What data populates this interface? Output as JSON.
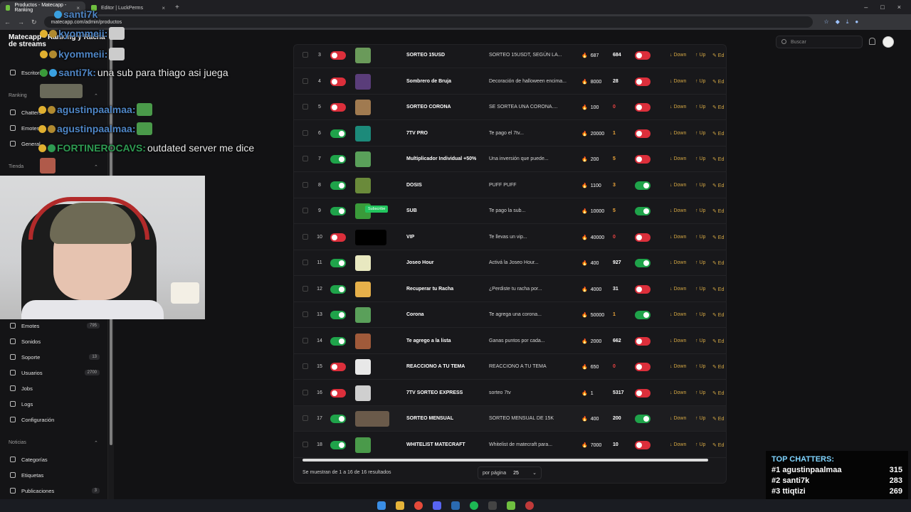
{
  "browser": {
    "tabs": [
      {
        "label": "Productos - Matecapp - Ranking",
        "active": true
      },
      {
        "label": "Editor | LuckPerms",
        "active": false
      }
    ],
    "url": "matecapp.com/admin/productos",
    "new_tab": "+"
  },
  "sidebar": {
    "brand": "Matecapp - Ranking y Racha de streams",
    "items_top": [
      {
        "label": "Escritorio"
      }
    ],
    "section_ranking": "Ranking",
    "ranking_items": [
      {
        "label": "Chatters"
      },
      {
        "label": "Emotes"
      },
      {
        "label": "General"
      }
    ],
    "section_tienda": "Tienda",
    "items_bottom": [
      {
        "label": "Emotes",
        "badge": "795"
      },
      {
        "label": "Sonidos",
        "badge": ""
      },
      {
        "label": "Soporte",
        "badge": "13"
      },
      {
        "label": "Usuarios",
        "badge": "2700"
      },
      {
        "label": "Jobs",
        "badge": ""
      },
      {
        "label": "Logs",
        "badge": ""
      },
      {
        "label": "Configuración",
        "badge": ""
      }
    ],
    "section_noticias": "Noticias",
    "noticias_items": [
      {
        "label": "Categorías",
        "badge": ""
      },
      {
        "label": "Etiquetas",
        "badge": ""
      },
      {
        "label": "Publicaciones",
        "badge": "3"
      }
    ]
  },
  "chat": [
    {
      "nick": "santi7k",
      "msg": "",
      "color": "#4f86c6"
    },
    {
      "nick": "kyommeii:",
      "msg": "",
      "color": "#4f86c6"
    },
    {
      "nick": "kyommeii:",
      "msg": "",
      "color": "#4f86c6"
    },
    {
      "nick": "santi7k:",
      "msg": "una sub para thiago asi juega",
      "color": "#4f86c6"
    },
    {
      "nick": "agustinpaalmaa:",
      "msg": "",
      "color": "#4f86c6"
    },
    {
      "nick": "agustinpaalmaa:",
      "msg": "",
      "color": "#4f86c6"
    },
    {
      "nick": "FORTINEROCAVS:",
      "msg": "outdated server me dice",
      "color": "#2e9b52"
    }
  ],
  "header": {
    "search_placeholder": "Buscar"
  },
  "table": {
    "rows": [
      {
        "num": "3",
        "active": false,
        "name": "SORTEO 15USD",
        "desc": "SORTEO 15USDT, SEGÚN LA...",
        "cost": "687",
        "stock": "684",
        "stock_state": "normal",
        "visible": false,
        "thumb": "#6a9a5a"
      },
      {
        "num": "4",
        "active": false,
        "name": "Sombrero de Bruja",
        "desc": "Decoración de halloween encima...",
        "cost": "8000",
        "stock": "28",
        "stock_state": "normal",
        "visible": false,
        "thumb": "#5a3d7a"
      },
      {
        "num": "5",
        "active": false,
        "name": "SORTEO CORONA",
        "desc": "SE SORTEA UNA CORONA....",
        "cost": "100",
        "stock": "0",
        "stock_state": "zero",
        "visible": false,
        "thumb": "#a07a50"
      },
      {
        "num": "6",
        "active": true,
        "name": "7TV PRO",
        "desc": "Te pago el 7tv...",
        "cost": "20000",
        "stock": "1",
        "stock_state": "warn",
        "visible": false,
        "thumb": "#1c8a7a"
      },
      {
        "num": "7",
        "active": true,
        "name": "Multiplicador Individual +50%",
        "desc": "Una inversión que puede...",
        "cost": "200",
        "stock": "5",
        "stock_state": "warn",
        "visible": false,
        "thumb": "#5aa05a"
      },
      {
        "num": "8",
        "active": true,
        "name": "DOSIS",
        "desc": "PUFF PUFF",
        "cost": "1100",
        "stock": "3",
        "stock_state": "warn",
        "visible": true,
        "thumb": "#6a8a3a"
      },
      {
        "num": "9",
        "active": true,
        "name": "SUB",
        "desc": "Te pago la sub...",
        "cost": "10000",
        "stock": "5",
        "stock_state": "warn",
        "visible": true,
        "thumb": "#3a9a3a"
      },
      {
        "num": "10",
        "active": false,
        "name": "VIP",
        "desc": "Te llevas un vip...",
        "cost": "40000",
        "stock": "0",
        "stock_state": "zero",
        "visible": false,
        "thumb": "#000000"
      },
      {
        "num": "11",
        "active": true,
        "name": "Joseo Hour",
        "desc": "Activá la Joseo Hour...",
        "cost": "400",
        "stock": "927",
        "stock_state": "normal",
        "visible": true,
        "thumb": "#e8e8c0"
      },
      {
        "num": "12",
        "active": true,
        "name": "Recuperar tu Racha",
        "desc": "¿Perdiste tu racha por...",
        "cost": "4000",
        "stock": "31",
        "stock_state": "normal",
        "visible": false,
        "thumb": "#e6b04a"
      },
      {
        "num": "13",
        "active": true,
        "name": "Corona",
        "desc": "Te agrega una corona...",
        "cost": "50000",
        "stock": "1",
        "stock_state": "warn",
        "visible": true,
        "thumb": "#5aa05a"
      },
      {
        "num": "14",
        "active": true,
        "name": "Te agrego a la lista",
        "desc": "Ganas puntos por cada...",
        "cost": "2000",
        "stock": "662",
        "stock_state": "normal",
        "visible": false,
        "thumb": "#a05a3a"
      },
      {
        "num": "15",
        "active": false,
        "name": "REACCIONO A TU TEMA",
        "desc": "REACCIONO A TU TEMA",
        "cost": "650",
        "stock": "0",
        "stock_state": "zero",
        "visible": false,
        "thumb": "#e8e8e8"
      },
      {
        "num": "16",
        "active": false,
        "name": "7TV SORTEO EXPRESS",
        "desc": "sorteo 7tv",
        "cost": "1",
        "stock": "5317",
        "stock_state": "normal",
        "visible": false,
        "thumb": "#cfcfcf"
      },
      {
        "num": "17",
        "active": true,
        "name": "SORTEO MENSUAL",
        "desc": "SORTEO MENSUAL DE 15K",
        "cost": "400",
        "stock": "200",
        "stock_state": "normal",
        "visible": true,
        "thumb": "#6a5a4a"
      },
      {
        "num": "18",
        "active": true,
        "name": "WHITELIST MATECRAFT",
        "desc": "Whitelist de matecraft para...",
        "cost": "7000",
        "stock": "10",
        "stock_state": "normal",
        "visible": false,
        "thumb": "#4a9a4a"
      }
    ],
    "actions": {
      "down": "↓ Down",
      "up": "↑ Up",
      "edit": "✎ Ed"
    },
    "subscribe_tag": "Subscribe",
    "footer": "Se muestran de 1 a 16 de 16 resultados",
    "per_page_label": "por página",
    "per_page_value": "25"
  },
  "top_chatters": {
    "title": "TOP CHATTERS:",
    "entries": [
      {
        "rank": "#1",
        "name": "agustinpaalmaa",
        "count": "315"
      },
      {
        "rank": "#2",
        "name": "santi7k",
        "count": "283"
      },
      {
        "rank": "#3",
        "name": "ttiqtizi",
        "count": "269"
      }
    ]
  },
  "colors": {
    "accent_on": "#1fa34a",
    "accent_off": "#dc2f3b",
    "action": "#d5a844"
  }
}
